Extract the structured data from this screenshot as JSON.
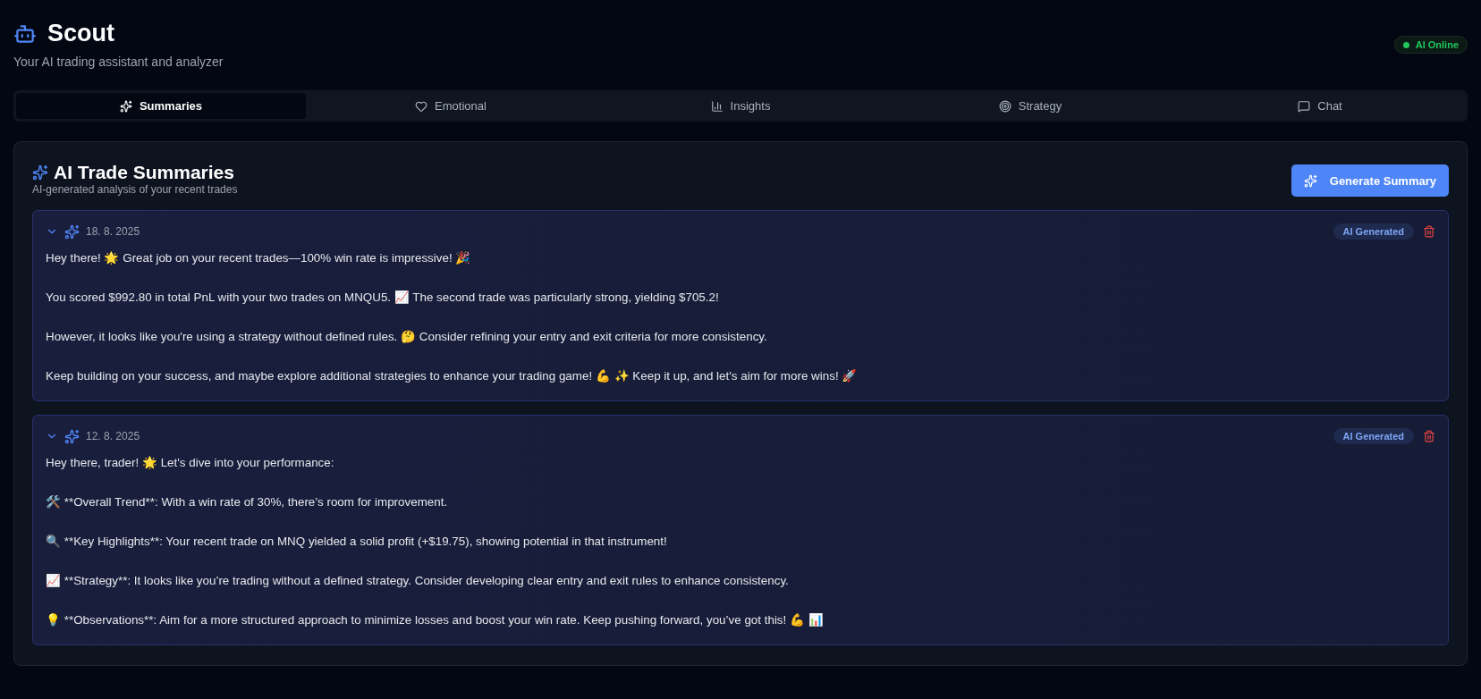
{
  "header": {
    "title": "Scout",
    "subtitle": "Your AI trading assistant and analyzer",
    "status": {
      "label": "AI Online",
      "color": "#22c55e"
    }
  },
  "tabs": [
    {
      "label": "Summaries",
      "kind": "sparkles",
      "selected": true
    },
    {
      "label": "Emotional",
      "kind": "heart",
      "selected": false
    },
    {
      "label": "Insights",
      "kind": "chart",
      "selected": false
    },
    {
      "label": "Strategy",
      "kind": "target",
      "selected": false
    },
    {
      "label": "Chat",
      "kind": "chat",
      "selected": false
    }
  ],
  "panel": {
    "title": "AI Trade Summaries",
    "subtitle": "AI-generated analysis of your recent trades",
    "button": "Generate Summary",
    "summaries": [
      {
        "date": "18. 8. 2025",
        "badge": "AI Generated",
        "expanded": true,
        "paragraphs": [
          "Hey there! 🌟 Great job on your recent trades—100% win rate is impressive! 🎉",
          "You scored $992.80 in total PnL with your two trades on MNQU5. 📈 The second trade was particularly strong, yielding $705.2!",
          "However, it looks like you're using a strategy without defined rules. 🤔 Consider refining your entry and exit criteria for more consistency.",
          "Keep building on your success, and maybe explore additional strategies to enhance your trading game! 💪 ✨ Keep it up, and let's aim for more wins! 🚀"
        ]
      },
      {
        "date": "12. 8. 2025",
        "badge": "AI Generated",
        "expanded": true,
        "paragraphs": [
          "Hey there, trader! 🌟 Let's dive into your performance:",
          "🛠️ **Overall Trend**: With a win rate of 30%, there’s room for improvement.",
          "🔍 **Key Highlights**: Your recent trade on MNQ yielded a solid profit (+$19.75), showing potential in that instrument!",
          "📈 **Strategy**: It looks like you’re trading without a defined strategy. Consider developing clear entry and exit rules to enhance consistency.",
          "💡 **Observations**: Aim for a more structured approach to minimize losses and boost your win rate. Keep pushing forward, you’ve got this! 💪 📊"
        ]
      }
    ]
  }
}
